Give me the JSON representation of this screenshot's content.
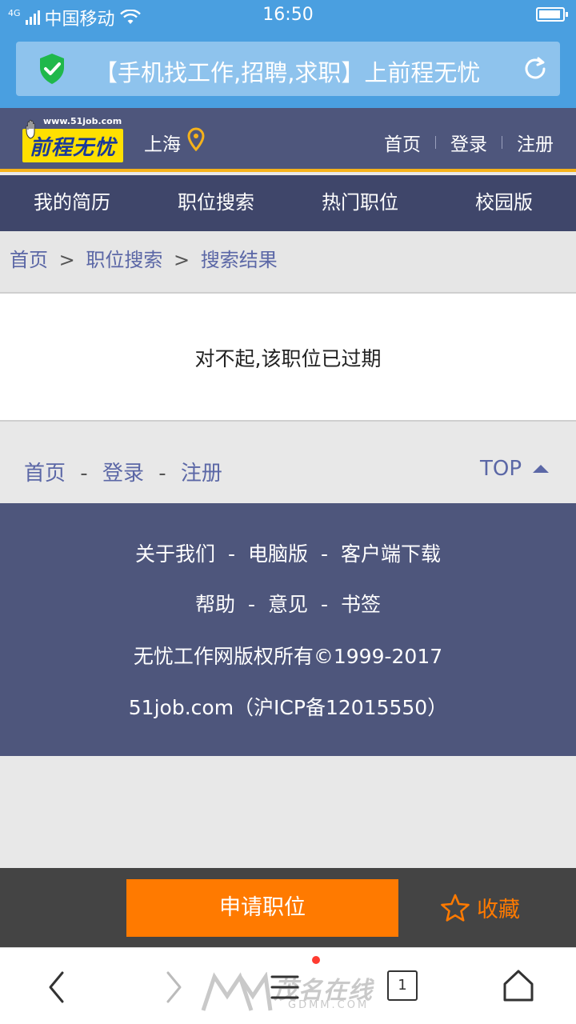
{
  "status_bar": {
    "network": "4G",
    "carrier": "中国移动",
    "time": "16:50"
  },
  "url_bar": {
    "title": "【手机找工作,招聘,求职】上前程无忧"
  },
  "header": {
    "logo_url": "www.51job.com",
    "logo_text": "前程无忧",
    "city": "上海",
    "nav": {
      "home": "首页",
      "login": "登录",
      "register": "注册"
    }
  },
  "main_menu": [
    {
      "label": "我的简历"
    },
    {
      "label": "职位搜索"
    },
    {
      "label": "热门职位"
    },
    {
      "label": "校园版"
    }
  ],
  "breadcrumb": {
    "home": "首页",
    "sep": ">",
    "job_search": "职位搜索",
    "results": "搜索结果"
  },
  "content": {
    "message": "对不起,该职位已过期"
  },
  "footer_nav": {
    "home": "首页",
    "login": "登录",
    "register": "注册",
    "sep": "-",
    "top": "TOP"
  },
  "footer_info": {
    "about": "关于我们",
    "pc": "电脑版",
    "client": "客户端下载",
    "help": "帮助",
    "feedback": "意见",
    "bookmark": "书签",
    "sep": "-",
    "copyright": "无忧工作网版权所有©1999-2017",
    "icp": "51job.com（沪ICP备12015550）"
  },
  "action_bar": {
    "apply": "申请职位",
    "favorite": "收藏"
  },
  "browser_bar": {
    "tab_count": "1",
    "watermark": "茂名在线",
    "watermark_sub": "GDMM.COM"
  },
  "colors": {
    "status_blue": "#4a9fe0",
    "header_navy": "#4e567c",
    "menu_navy": "#3f466a",
    "accent_yellow": "#f5b21b",
    "link_blue": "#5b67a6",
    "orange": "#ff7a00",
    "shield_green": "#1fb84b"
  }
}
